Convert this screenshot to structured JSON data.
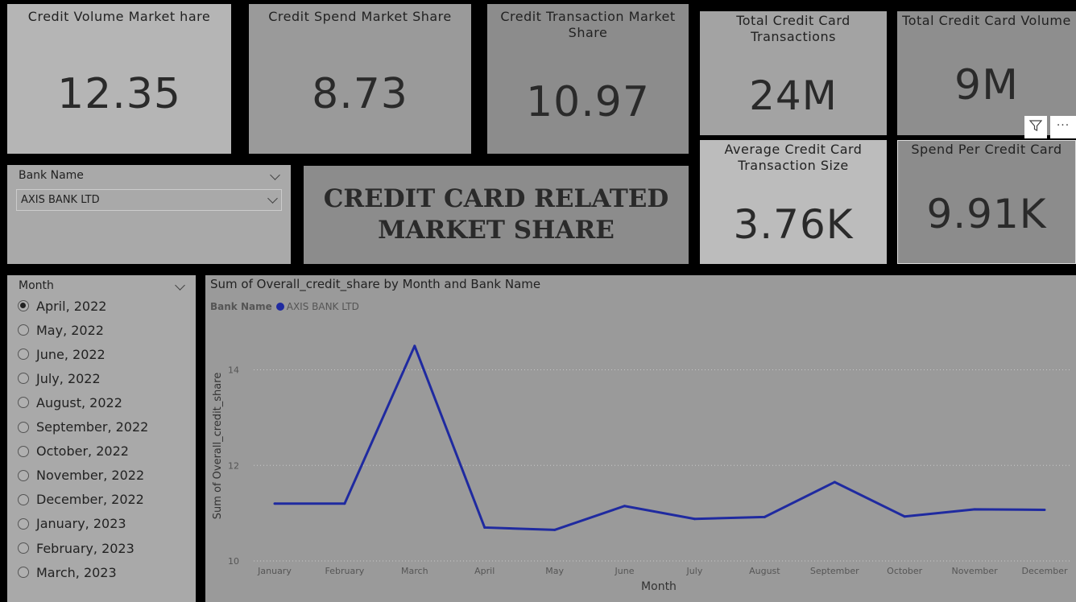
{
  "cards": {
    "credit_volume": {
      "title": "Credit Volume Market hare",
      "value": "12.35"
    },
    "credit_spend": {
      "title": "Credit Spend Market Share",
      "value": "8.73"
    },
    "credit_transaction": {
      "title": "Credit Transaction Market Share",
      "value": "10.97"
    },
    "total_transactions": {
      "title": "Total Credit Card Transactions",
      "value": "24M"
    },
    "total_volume": {
      "title": "Total Credit Card Volume",
      "value": "9M"
    },
    "avg_transaction_size": {
      "title": "Average Credit Card Transaction Size",
      "value": "3.76K"
    },
    "spend_per_card": {
      "title": "Spend Per Credit Card",
      "value": "9.91K"
    }
  },
  "banner": {
    "line1": "CREDIT CARD RELATED",
    "line2": "MARKET SHARE"
  },
  "bank_slicer": {
    "label": "Bank Name",
    "selected": "AXIS BANK LTD"
  },
  "month_slicer": {
    "label": "Month",
    "options": [
      "April, 2022",
      "May, 2022",
      "June, 2022",
      "July, 2022",
      "August, 2022",
      "September, 2022",
      "October, 2022",
      "November, 2022",
      "December, 2022",
      "January, 2023",
      "February, 2023",
      "March, 2023"
    ],
    "selected_index": 0
  },
  "visual_header": {
    "filter_icon": "filter-icon",
    "more_icon": "more-options-icon",
    "more_label": "···"
  },
  "chart_data": {
    "type": "line",
    "title": "Sum of Overall_credit_share by Month and Bank Name",
    "legend_title": "Bank Name",
    "xlabel": "Month",
    "ylabel": "Sum of Overall_credit_share",
    "categories": [
      "January",
      "February",
      "March",
      "April",
      "May",
      "June",
      "July",
      "August",
      "September",
      "October",
      "November",
      "December"
    ],
    "series": [
      {
        "name": "AXIS BANK LTD",
        "color": "#1f2aa0",
        "values": [
          11.2,
          11.2,
          14.5,
          10.7,
          10.65,
          11.15,
          10.88,
          10.92,
          11.65,
          10.93,
          11.08,
          11.07
        ]
      }
    ],
    "ylim": [
      10,
      14.8
    ],
    "yticks": [
      "10",
      "12",
      "14"
    ],
    "grid": true,
    "legend_position": "top-left"
  }
}
